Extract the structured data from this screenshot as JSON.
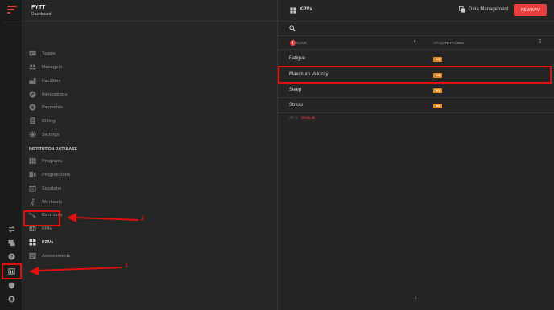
{
  "app": {
    "title": "FYTT",
    "subtitle": "Dashboard"
  },
  "rail": {
    "buttons": [
      {
        "name": "swap-icon"
      },
      {
        "name": "chat-icon"
      },
      {
        "name": "help-icon"
      },
      {
        "name": "library-icon"
      },
      {
        "name": "security-icon"
      },
      {
        "name": "account-icon"
      }
    ]
  },
  "sidebar": {
    "items": [
      {
        "label": "Teams",
        "icon": "id-card-icon"
      },
      {
        "label": "Managers",
        "icon": "people-icon"
      },
      {
        "label": "Facilities",
        "icon": "factory-icon"
      },
      {
        "label": "Integrations",
        "icon": "link-icon"
      },
      {
        "label": "Payments",
        "icon": "dollar-icon"
      },
      {
        "label": "Billing",
        "icon": "receipt-icon"
      },
      {
        "label": "Settings",
        "icon": "gear-icon"
      }
    ],
    "section_title": "INSTITUTION DATABASE",
    "db_items": [
      {
        "label": "Programs",
        "icon": "grid-icon"
      },
      {
        "label": "Progressions",
        "icon": "progression-icon"
      },
      {
        "label": "Sessions",
        "icon": "calendar-icon"
      },
      {
        "label": "Workouts",
        "icon": "running-icon"
      },
      {
        "label": "Exercises",
        "icon": "exercise-icon"
      },
      {
        "label": "KPIs",
        "icon": "chart-icon"
      },
      {
        "label": "KPVs",
        "icon": "kpv-grid-icon"
      },
      {
        "label": "Assessments",
        "icon": "clipboard-icon"
      }
    ]
  },
  "main": {
    "title": "KPVs",
    "data_management_label": "Data Management",
    "new_button_label": "NEW KPV",
    "search_placeholder": "",
    "columns": {
      "name": "NAME",
      "athlete_facing": "ATHLETE FACING",
      "info": "i"
    },
    "rows": [
      {
        "name": "Fatigue",
        "badge": "NO"
      },
      {
        "name": "Maximum Velocity",
        "badge": "NO"
      },
      {
        "name": "Sleep",
        "badge": "NO"
      },
      {
        "name": "Stress",
        "badge": "NO"
      }
    ],
    "footer": {
      "count": "All: 4",
      "show_all": "Show all"
    },
    "page": "1"
  },
  "annotations": {
    "label1": "1",
    "label2": "2"
  },
  "colors": {
    "accent": "#e8403f",
    "highlight": "#e01010",
    "badge": "#e88a19"
  }
}
